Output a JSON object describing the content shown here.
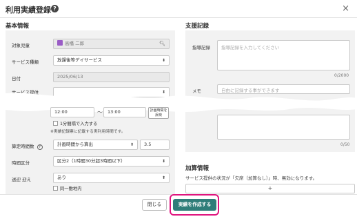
{
  "modal": {
    "title": "利用実績登録",
    "help_icon_text": "?",
    "close_icon": "×"
  },
  "basic_info": {
    "heading": "基本情報",
    "target_child_label": "対象児童",
    "target_child_value": "高橋 二郎",
    "service_type_label": "サービス種類",
    "service_type_value": "放課後等デイサービス",
    "date_label": "日付",
    "date_value": "2025/06/13",
    "service_provision_label": "サービス提供",
    "time_start": "12:00",
    "time_separator": "〜",
    "time_end": "13:00",
    "calc_button_label": "計画時間を反映",
    "one_minute_checkbox_label": "1分間隔で入力する",
    "actual_time_note": "※実績記録票に記載する実利用時間です。",
    "calc_hours_label": "算定時間数",
    "calc_hours_help": "?",
    "calc_hours_method": "計画時間から算出",
    "calc_hours_value": "3.5",
    "time_category_label": "時間区分",
    "time_category_value": "区分2（1時間30分超3時間以下）",
    "transport_label": "送迎 迎え",
    "transport_value": "あり",
    "same_site_checkbox_label": "同一敷地内"
  },
  "support_record": {
    "heading": "支援記録",
    "guidance_label": "指導記録",
    "guidance_placeholder": "指導記録を入力してください",
    "guidance_counter": "0/2000",
    "memo_label": "メモ",
    "memo_placeholder": "自由に記録する事ができます",
    "memo_counter": "0/50"
  },
  "addition_info": {
    "heading": "加算情報",
    "note": "サービス提供の状況が「欠席（加算なし）」時、無効になります。",
    "add_button_label": "+"
  },
  "footer": {
    "close_label": "閉じる",
    "create_label": "実績を作成する"
  },
  "colors": {
    "primary_button": "#2f7d79",
    "highlight_border": "#e0147e",
    "panel_background": "#f2f2f2"
  }
}
